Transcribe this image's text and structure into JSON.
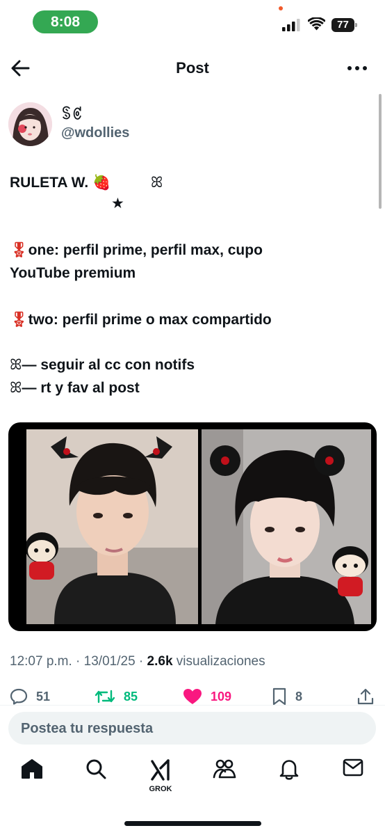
{
  "status_bar": {
    "time": "8:08",
    "battery": "77"
  },
  "header": {
    "title": "Post"
  },
  "author": {
    "display_name": "ꌗꏳ",
    "handle": "@wdollies"
  },
  "tweet": {
    "line1": "RULETA W. 🍓",
    "line1_deco": "ꕤ",
    "star": "★",
    "medal": "🎖",
    "prize_one": "one: perfil prime, perfil max, cupo",
    "prize_one_cont": "YouTube premium",
    "prize_two": "two: perfil prime o max compartido",
    "rule_icon": "ꕤ",
    "rule1": "— seguir al cc con notifs",
    "rule2": "— rt y fav al post"
  },
  "meta": {
    "time": "12:07 p.m.",
    "separator": " · ",
    "date": "13/01/25",
    "views_count": "2.6k",
    "views_label": " visualizaciones"
  },
  "actions": {
    "replies": "51",
    "reposts": "85",
    "likes": "109",
    "bookmarks": "8"
  },
  "reply_box": {
    "placeholder": "Postea tu respuesta"
  },
  "bottom_nav": {
    "grok_label": "GROK"
  },
  "colors": {
    "status_pill": "#34a853",
    "like": "#f91880",
    "repost": "#00ba7c",
    "secondary_text": "#536471"
  }
}
